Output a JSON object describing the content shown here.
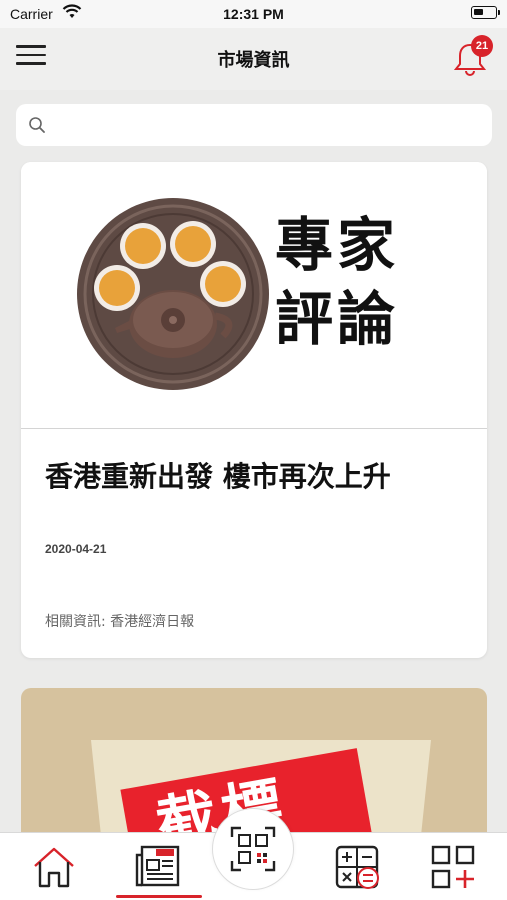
{
  "status_bar": {
    "carrier": "Carrier",
    "time": "12:31 PM"
  },
  "header": {
    "title": "市場資訊",
    "notification_count": "21"
  },
  "search": {
    "placeholder": ""
  },
  "articles": [
    {
      "image_caption": [
        "專家",
        "評論"
      ],
      "headline": "香港重新出發 樓市再次上升",
      "date": "2020-04-21",
      "related": "相關資訊: 香港經濟日報"
    },
    {
      "image_caption": "截標"
    }
  ],
  "tab_bar": {
    "items": [
      {
        "icon": "home-icon",
        "active": false
      },
      {
        "icon": "news-icon",
        "active": true
      },
      {
        "icon": "qr-scan-icon",
        "active": false
      },
      {
        "icon": "calculator-icon",
        "active": false
      },
      {
        "icon": "apps-add-icon",
        "active": false
      }
    ],
    "news_icon_text": "NEWS"
  },
  "colors": {
    "accent": "#d8232a",
    "background": "#ebebea",
    "card": "#ffffff"
  }
}
